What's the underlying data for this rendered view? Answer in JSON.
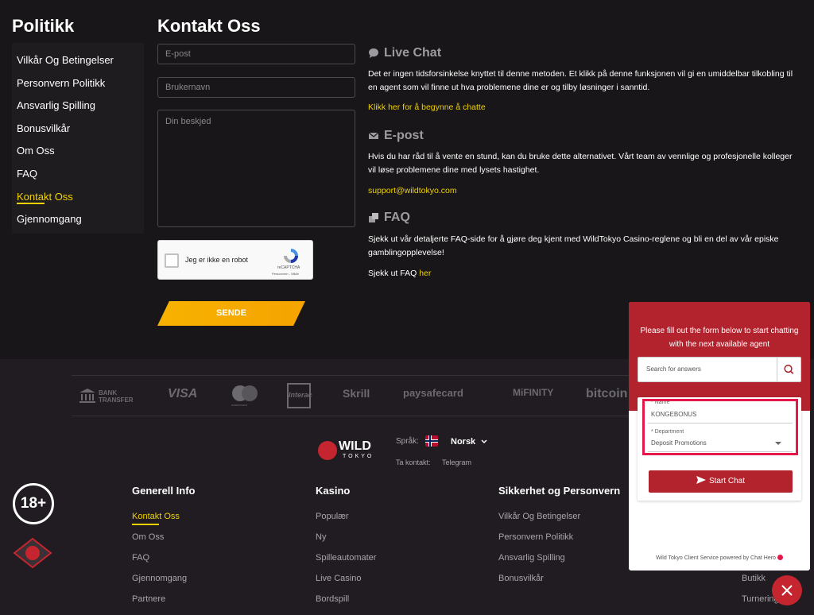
{
  "sidebar": {
    "title": "Politikk",
    "items": [
      {
        "label": "Vilkår Og Betingelser"
      },
      {
        "label": "Personvern Politikk"
      },
      {
        "label": "Ansvarlig Spilling"
      },
      {
        "label": "Bonusvilkår"
      },
      {
        "label": "Om Oss"
      },
      {
        "label": "FAQ"
      },
      {
        "label": "Kontakt Oss",
        "active": true
      },
      {
        "label": "Gjennomgang"
      }
    ]
  },
  "contact": {
    "title": "Kontakt Oss",
    "email_placeholder": "E-post",
    "username_placeholder": "Brukernavn",
    "message_placeholder": "Din beskjed",
    "captcha_label": "Jeg er ikke en robot",
    "captcha_brand": "reCAPTCHA",
    "captcha_links": "Personvern - Vilkår",
    "send_label": "SENDE"
  },
  "info": {
    "live_chat": {
      "title": "Live Chat",
      "text": "Det er ingen tidsforsinkelse knyttet til denne metoden. Et klikk på denne funksjonen vil gi en umiddelbar tilkobling til en agent som vil finne ut hva problemene dine er og tilby løsninger i sanntid.",
      "link": "Klikk her for å begynne å chatte"
    },
    "email": {
      "title": "E-post",
      "text": "Hvis du har råd til å vente en stund, kan du bruke dette alternativet. Vårt team av vennlige og profesjonelle kolleger vil løse problemene dine med lysets hastighet.",
      "link": "support@wildtokyo.com"
    },
    "faq": {
      "title": "FAQ",
      "text": "Sjekk ut vår detaljerte FAQ-side for å gjøre deg kjent med WildTokyo Casino-reglene og bli en del av vår episke gamblingopplevelse!",
      "prefix": "Sjekk ut FAQ ",
      "link": "her"
    }
  },
  "payments": [
    "BANK TRANSFER",
    "VISA",
    "mastercard",
    "Interac",
    "Skrill",
    "paysafecard",
    "MiFINITY",
    "bitcoin"
  ],
  "footer": {
    "logo_top": "WILD",
    "logo_bottom": "TOKYO",
    "lang_label": "Språk:",
    "lang_value": "Norsk",
    "contact_label": "Ta kontakt:",
    "contact_value": "Telegram",
    "age": "18+",
    "columns": [
      {
        "title": "Generell Info",
        "links": [
          "Kontakt Oss",
          "Om Oss",
          "FAQ",
          "Gjennomgang",
          "Partnere"
        ]
      },
      {
        "title": "Kasino",
        "links": [
          "Populær",
          "Ny",
          "Spilleautomater",
          "Live Casino",
          "Bordspill"
        ]
      },
      {
        "title": "Sikkerhet og Personvern",
        "links": [
          "Vilkår Og Betingelser",
          "Personvern Politikk",
          "Ansvarlig Spilling",
          "Bonusvilkår"
        ]
      },
      {
        "title": "",
        "links": [
          "Butikk",
          "Turnering"
        ]
      }
    ]
  },
  "chat_widget": {
    "message": "Please fill out the form below to start chatting with the next available agent",
    "search_placeholder": "Search for answers",
    "name_label": "* Name",
    "name_value": "KONGEBONUS",
    "dept_label": "* Department",
    "dept_value": "Deposit Promotions",
    "start_label": "Start Chat",
    "footer": "Wild Tokyo Client Service powered by Chat Hero"
  },
  "colors": {
    "accent": "#f0d200",
    "button": "#f5a300",
    "chat_red": "#b3232d"
  }
}
